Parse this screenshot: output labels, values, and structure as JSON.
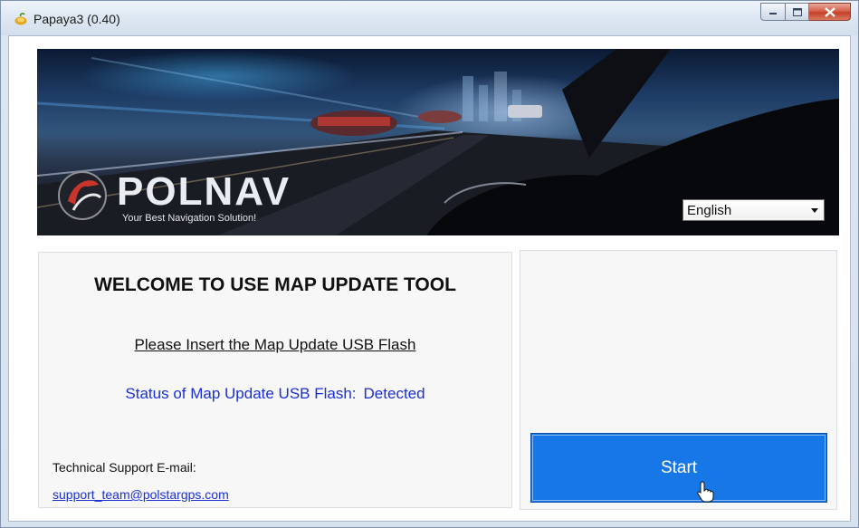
{
  "window": {
    "title": "Papaya3 (0.40)",
    "icon": "papaya-app-icon"
  },
  "banner": {
    "brand": "POLNAV",
    "tagline": "Your Best Navigation Solution!"
  },
  "language": {
    "selected": "English"
  },
  "welcome_panel": {
    "heading": "WELCOME TO USE MAP UPDATE TOOL",
    "instruction": "Please Insert the Map Update USB Flash",
    "status_label": "Status of Map Update USB Flash:",
    "status_value": "Detected",
    "support_label": "Technical Support E-mail:",
    "support_email": "support_team@polstargps.com"
  },
  "action_panel": {
    "start_label": "Start"
  },
  "colors": {
    "start_button": "#1877e6",
    "status_text": "#1a2fd6",
    "link": "#1a2fd6"
  }
}
